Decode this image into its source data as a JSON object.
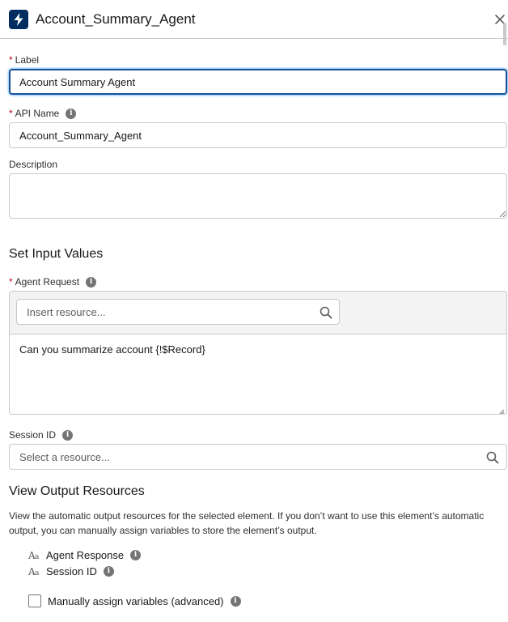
{
  "header": {
    "title": "Account_Summary_Agent",
    "icon": "lightning-bolt-icon"
  },
  "label_field": {
    "label": "Label",
    "value": "Account Summary Agent"
  },
  "api_name_field": {
    "label": "API Name",
    "value": "Account_Summary_Agent"
  },
  "description_field": {
    "label": "Description",
    "value": ""
  },
  "set_input_values": {
    "title": "Set Input Values",
    "agent_request": {
      "label": "Agent Request",
      "insert_placeholder": "Insert resource...",
      "value": "Can you summarize account {!$Record}"
    },
    "session_id": {
      "label": "Session ID",
      "placeholder": "Select a resource..."
    }
  },
  "view_output_resources": {
    "title": "View Output Resources",
    "description": "View the automatic output resources for the selected element. If you don’t want to use this element’s automatic output, you can manually assign variables to store the element’s output.",
    "resources": [
      {
        "name": "Agent Response",
        "type_icon": "text-type-icon"
      },
      {
        "name": "Session ID",
        "type_icon": "text-type-icon"
      }
    ],
    "manual_assign": {
      "label": "Manually assign variables (advanced)",
      "checked": false
    }
  },
  "colors": {
    "header_icon_bg": "#032d60",
    "focus_border": "#1b5297",
    "required": "#ba0517"
  }
}
